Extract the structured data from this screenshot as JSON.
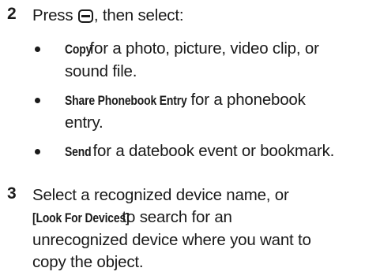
{
  "steps": [
    {
      "number": "2",
      "text_before_icon": "Press ",
      "icon": "menu-key-icon",
      "text_after_icon": ", then select:"
    },
    {
      "number": "3",
      "text_start": "Select a recognized device name, or",
      "bracket_label": "[Look For Devices]",
      "text_end_line2": " to search for an",
      "text_line3": "unrecognized device where you want to",
      "text_line4": "copy the object."
    }
  ],
  "bullets": [
    {
      "keyword": "Copy",
      "line1": " for a photo, picture, video clip, or",
      "line2": "sound file."
    },
    {
      "keyword": "Share Phonebook Entry",
      "line1": " for a phonebook",
      "line2": "entry."
    },
    {
      "keyword": "Send",
      "line1": " for a datebook event or bookmark.",
      "line2": ""
    }
  ]
}
